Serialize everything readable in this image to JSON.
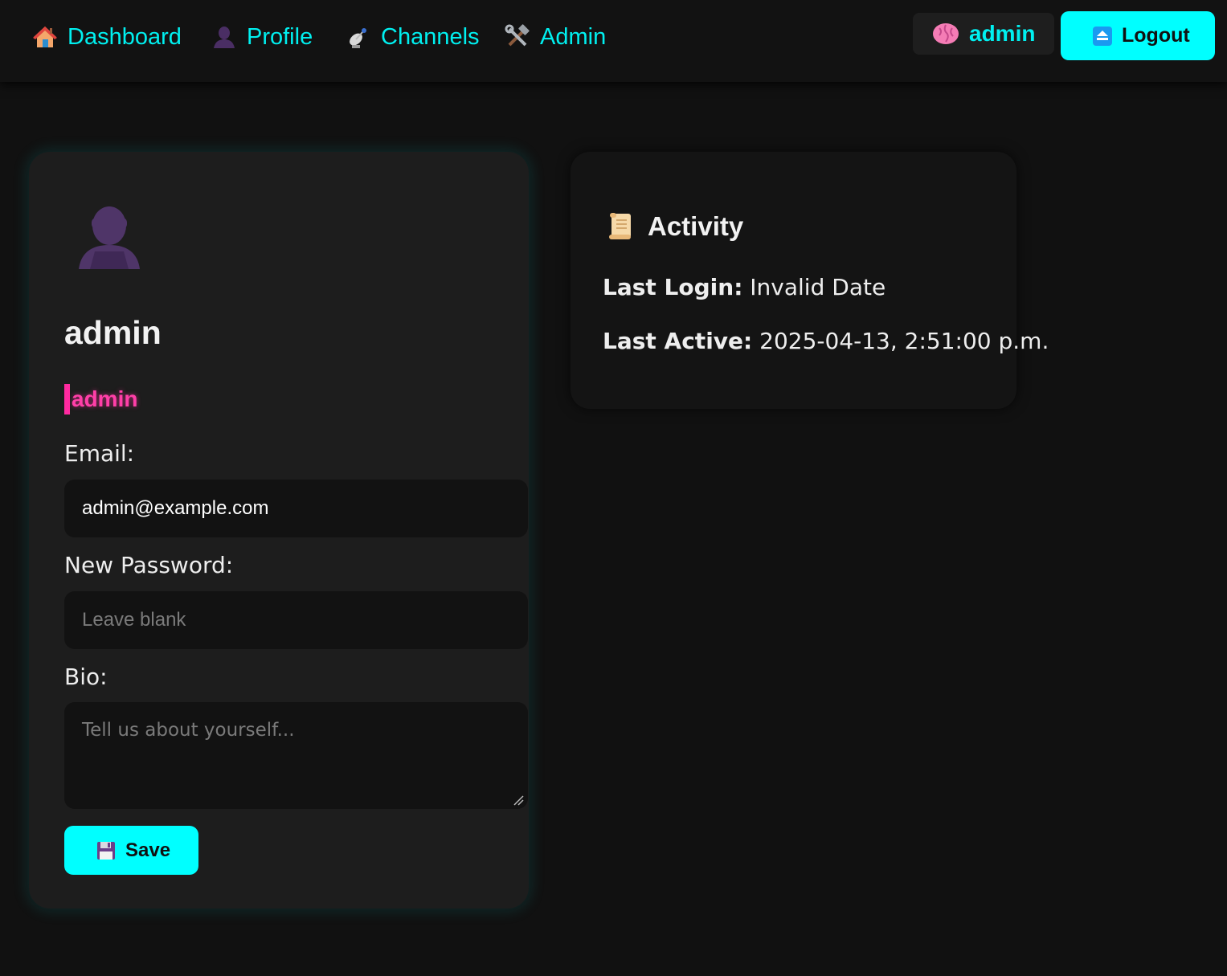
{
  "nav": {
    "links": [
      {
        "label": "Dashboard",
        "icon": "house-icon"
      },
      {
        "label": "Profile",
        "icon": "user-silhouette-icon"
      },
      {
        "label": "Channels",
        "icon": "satellite-dish-icon"
      },
      {
        "label": "Admin",
        "icon": "hammer-wrench-icon"
      }
    ],
    "user_chip": {
      "label": "admin",
      "icon": "brain-icon"
    },
    "logout": {
      "label": "Logout",
      "icon": "eject-icon"
    }
  },
  "profile": {
    "avatar_icon": "user-silhouette-icon",
    "name": "admin",
    "role": "admin",
    "email_label": "Email:",
    "email_value": "admin@example.com",
    "password_label": "New Password:",
    "password_placeholder": "Leave blank",
    "bio_label": "Bio:",
    "bio_placeholder": "Tell us about yourself...",
    "save_label": "Save",
    "save_icon": "floppy-disk-icon"
  },
  "activity": {
    "title": "Activity",
    "title_icon": "scroll-icon",
    "last_login_key": "Last Login:",
    "last_login_value": "Invalid Date",
    "last_active_key": "Last Active:",
    "last_active_value": "2025-04-13, 2:51:00 p.m."
  },
  "colors": {
    "accent": "#00ffff",
    "nav_link": "#00f0f0",
    "role_pink": "#ff3fa8",
    "background": "#111111",
    "card": "#1d1d1d"
  }
}
